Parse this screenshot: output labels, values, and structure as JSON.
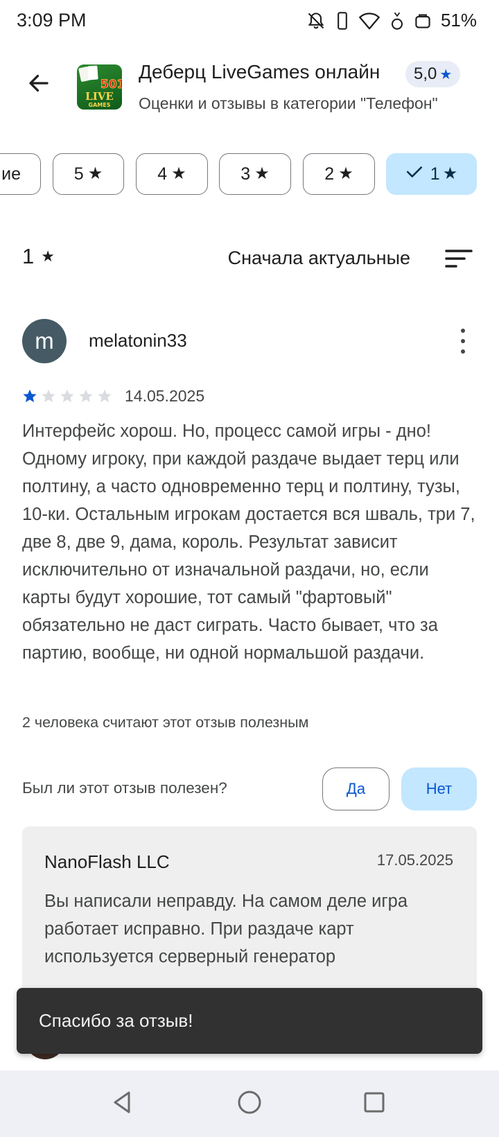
{
  "status_bar": {
    "time": "3:09 PM",
    "battery": "51%",
    "icons": [
      "bell-off-icon",
      "vibrate-icon",
      "wifi-icon",
      "data-saver-icon",
      "battery-icon"
    ]
  },
  "header": {
    "app_title": "Деберц LiveGames онлайн",
    "rating": "5,0",
    "subtitle": "Оценки и отзывы в категории \"Телефон\"",
    "app_icon_texts": [
      "501",
      "LIVE",
      "GAMES"
    ]
  },
  "filters": {
    "chips": [
      {
        "label": "ие",
        "selected": false
      },
      {
        "label": "5",
        "selected": false
      },
      {
        "label": "4",
        "selected": false
      },
      {
        "label": "3",
        "selected": false
      },
      {
        "label": "2",
        "selected": false
      },
      {
        "label": "1",
        "selected": true
      }
    ],
    "current_filter": "1",
    "sort_label": "Сначала актуальные"
  },
  "review": {
    "avatar_letter": "m",
    "author": "melatonin33",
    "rating": 1,
    "max_rating": 5,
    "date": "14.05.2025",
    "text": "Интерфейс хорош. Но, процесс самой игры - дно! Одному игроку, при каждой раздаче выдает терц или полтину, а часто одновременно терц и полтину, тузы, 10-ки. Остальным игрокам достается вся шваль, три 7, две 8, две 9, дама, король. Результат зависит исключительно от изначальной раздачи, но, если карты будут хорошие, тот самый \"фартовый\" обязательно не даст сиграть. Часто бывает, что за партию, вообще, ни одной нормальшой раздачи.",
    "helpful_count": "2 человека считают этот отзыв полезным",
    "helpful_question": "Был ли этот отзыв полезен?",
    "yes_label": "Да",
    "no_label": "Нет"
  },
  "reply": {
    "developer": "NanoFlash LLC",
    "date": "17.05.2025",
    "text": "Вы написали неправду. На самом деле игра работает исправно. При раздаче карт используется серверный генератор"
  },
  "snackbar": {
    "message": "Спасибо за отзыв!"
  },
  "colors": {
    "selected_chip": "#c2e7ff",
    "star_filled": "#0b57d0",
    "star_empty": "#dadce0",
    "snackbar_bg": "#313131"
  }
}
